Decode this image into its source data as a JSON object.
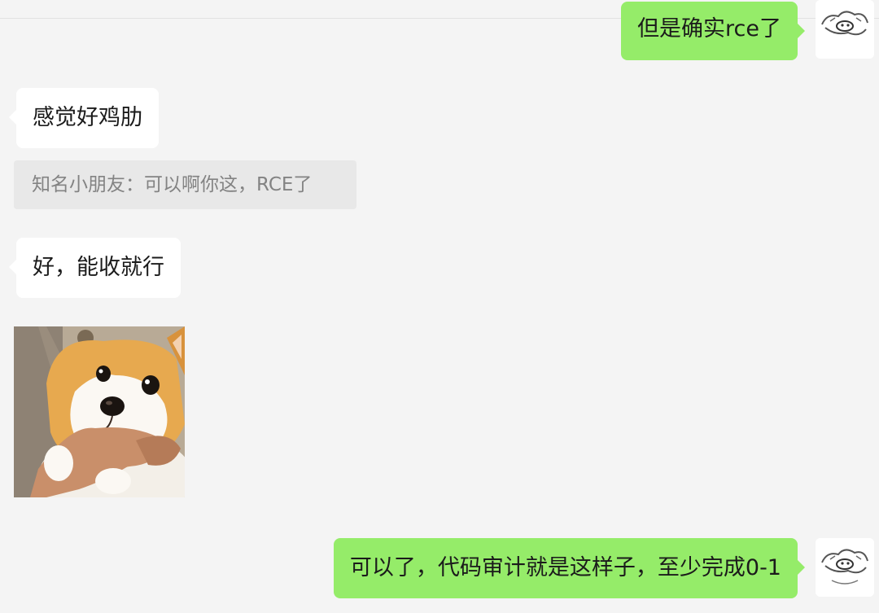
{
  "messages": [
    {
      "id": "m1",
      "sender": "self",
      "type": "text",
      "text": "但是确实rce了"
    },
    {
      "id": "m2",
      "sender": "other",
      "type": "text",
      "text": "感觉好鸡肋"
    },
    {
      "id": "m3",
      "sender": "other",
      "type": "quote",
      "text": "知名小朋友：可以啊你这，RCE了"
    },
    {
      "id": "m4",
      "sender": "other",
      "type": "text",
      "text": "好，能收就行"
    },
    {
      "id": "m5",
      "sender": "other",
      "type": "sticker",
      "sticker": "corgi-dog-sticker"
    },
    {
      "id": "m6",
      "sender": "self",
      "type": "text",
      "text": "可以了，代码审计就是这样子，至少完成0-1"
    }
  ],
  "colors": {
    "background": "#f4f4f4",
    "self_bubble": "#95ec69",
    "other_bubble": "#ffffff",
    "quote_bg": "#e8e8e8",
    "quote_text": "#838383"
  },
  "icons": {
    "self_avatar": "cartoon-sketch-avatar",
    "sticker": "corgi-dog-sticker"
  }
}
